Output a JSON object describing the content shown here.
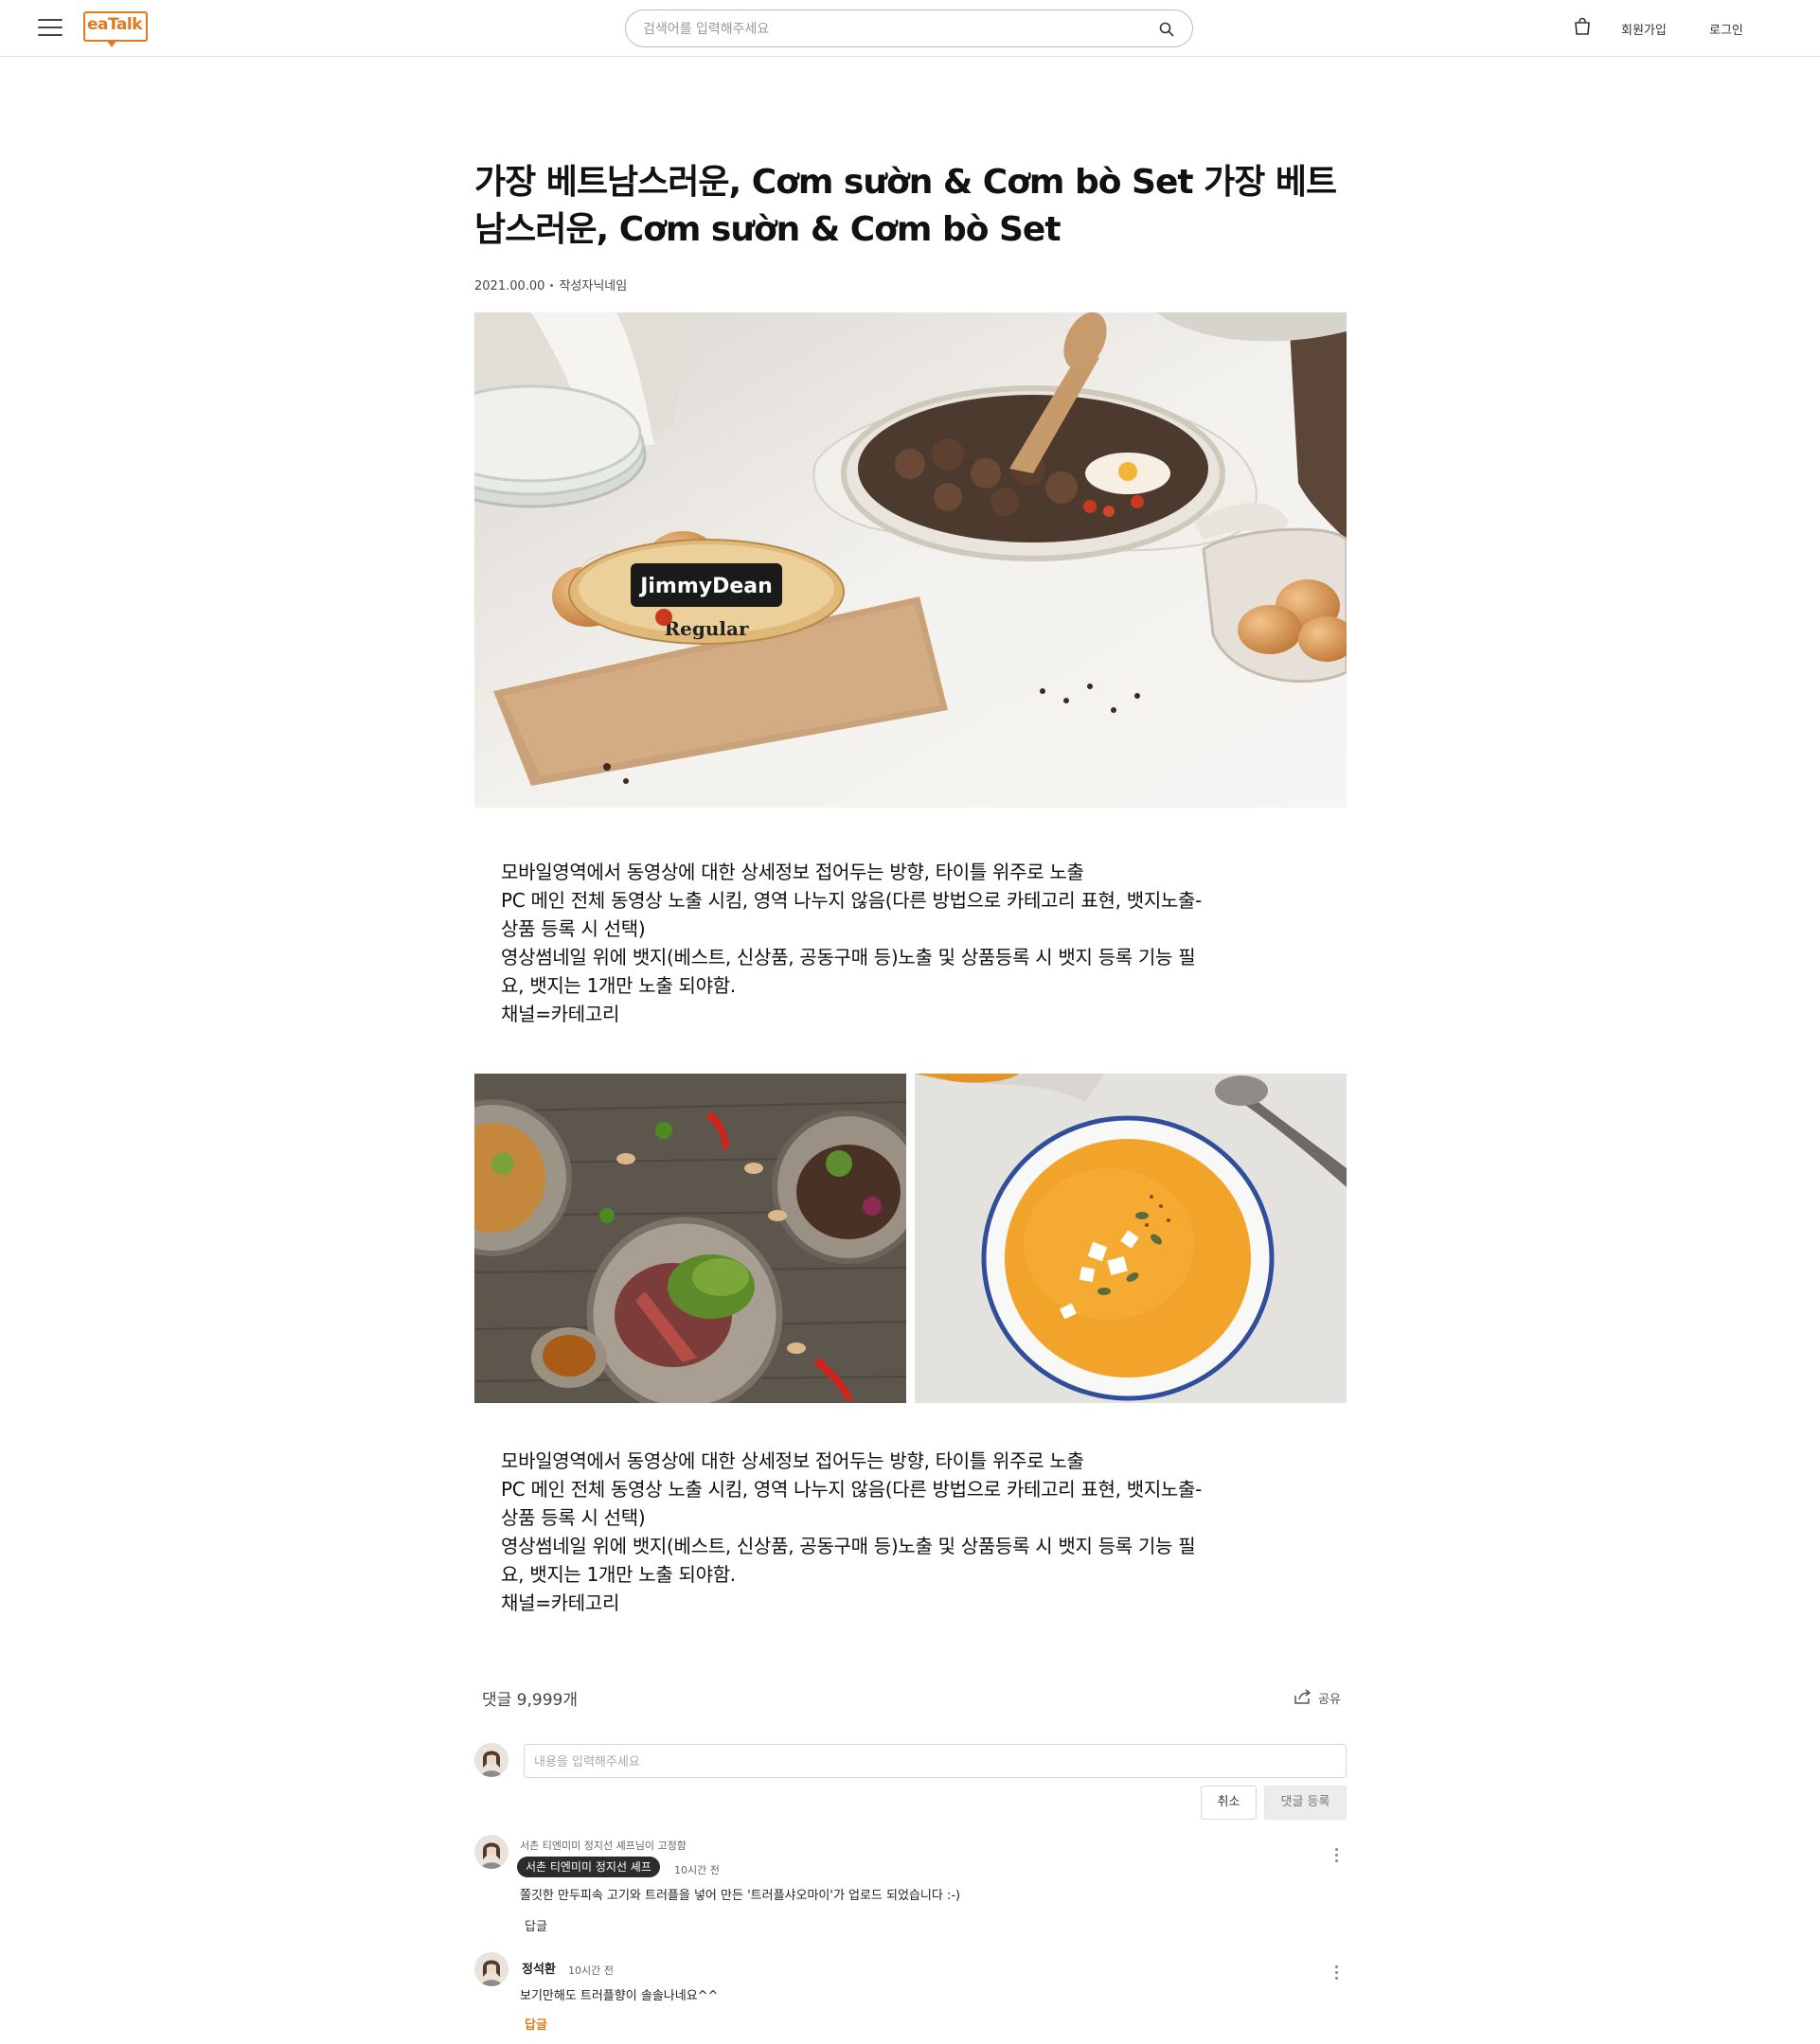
{
  "header": {
    "logo_text": "eaTalk",
    "search_placeholder": "검색어를 입력해주세요",
    "signup_label": "회원가입",
    "login_label": "로그인",
    "accent_color": "#e07a1a"
  },
  "article": {
    "title": "가장 베트남스러운,  Cơm sườn & Cơm bò Set 가장 베트남스러운,  Cơm sườn & Cơm bò Set",
    "date": "2021.00.00",
    "author": "작성자닉네임",
    "main_image": {
      "product_label_brand": "JimmyDean",
      "product_label_variant": "Regular"
    },
    "body_1": "모바일영역에서 동영상에 대한 상세정보 접어두는 방향, 타이틀 위주로 노출\nPC 메인 전체 동영상 노출 시킴, 영역 나누지 않음(다른 방법으로 카테고리 표현, 뱃지노출-\n상품 등록 시 선택)\n영상썸네일 위에 뱃지(베스트, 신상품, 공동구매 등)노출 및 상품등록 시 뱃지 등록 기능 필\n요, 뱃지는 1개만 노출 되야함.\n채널=카테고리",
    "body_2": "모바일영역에서 동영상에 대한 상세정보 접어두는 방향, 타이틀 위주로 노출\nPC 메인 전체 동영상 노출 시킴, 영역 나누지 않음(다른 방법으로 카테고리 표현, 뱃지노출-\n상품 등록 시 선택)\n영상썸네일 위에 뱃지(베스트, 신상품, 공동구매 등)노출 및 상품등록 시 뱃지 등록 기능 필\n요, 뱃지는 1개만 노출 되야함.\n채널=카테고리"
  },
  "comments": {
    "count_label": "댓글 9,999개",
    "share_label": "공유",
    "input_placeholder": "내용을 입력해주세요",
    "cancel_label": "취소",
    "submit_label": "댓글 등록",
    "items": [
      {
        "pinned_label": "서촌 티엔미미 정지선 셰프님이 고정함",
        "author": "서촌 티엔미미 정지선 셰프",
        "time": "10시간 전",
        "text": "쫄깃한 만두피속 고기와 트러플을 넣어 만든 '트러플샤오마이'가 업로드 되었습니다 :-)",
        "reply_label": "답글"
      },
      {
        "author": "정석환",
        "time": "10시간 전",
        "text": "보기만해도 트러플향이 솔솔나네요^^",
        "reply_label": "답글"
      }
    ]
  }
}
